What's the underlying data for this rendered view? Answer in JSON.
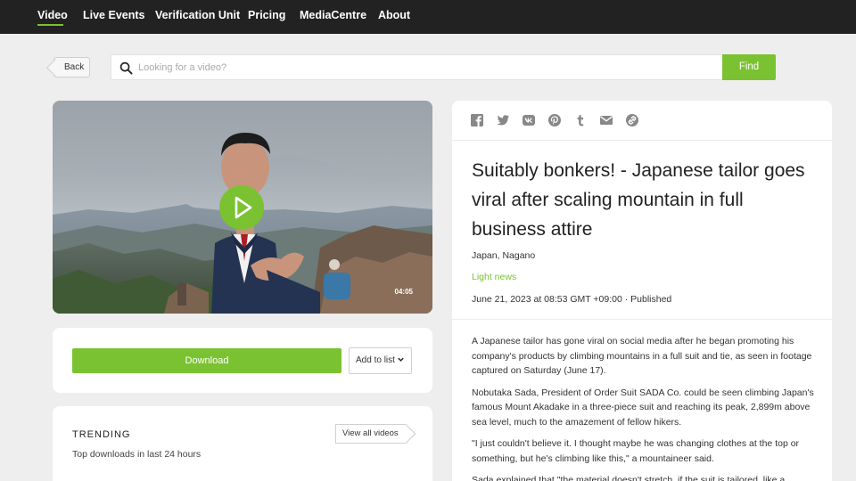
{
  "nav": {
    "items": [
      "Video",
      "Live Events",
      "Verification Unit",
      "Pricing",
      "MediaCentre",
      "About"
    ],
    "active": "Video"
  },
  "search": {
    "back_label": "Back",
    "placeholder": "Looking for a video?",
    "value": "",
    "find_label": "Find"
  },
  "video": {
    "duration": "04:05"
  },
  "actions": {
    "download_label": "Download",
    "add_to_list_label": "Add to list"
  },
  "trending": {
    "title": "TRENDING",
    "subtitle": "Top downloads in last 24 hours",
    "view_all_label": "View all videos"
  },
  "share": {
    "icons": [
      "facebook-icon",
      "twitter-icon",
      "vk-icon",
      "pinterest-icon",
      "tumblr-icon",
      "email-icon",
      "link-icon"
    ]
  },
  "article": {
    "headline": "Suitably bonkers! - Japanese tailor goes viral after scaling mountain in full business attire",
    "location": "Japan, Nagano",
    "category": "Light news",
    "published": "June 21, 2023 at 08:53 GMT +09:00 · Published",
    "paragraphs": [
      "A Japanese tailor has gone viral on social media after he began promoting his company's products by climbing mountains in a full suit and tie, as seen in footage captured on Saturday (June 17).",
      "Nobutaka Sada, President of Order Suit SADA Co. could be seen climbing Japan's famous Mount Akadake in a three-piece suit and reaching its peak, 2,899m above sea level, much to the amazement of fellow hikers.",
      "\"I just couldn't believe it. I thought maybe he was changing clothes at the top or something, but he's climbing like this,\" a mountaineer said.",
      "Sada explained that \"the material doesn't stretch, if the suit is tailored, like a"
    ]
  },
  "colors": {
    "accent": "#7ac231",
    "nav_bg": "#222222",
    "page_bg": "#eeeeee"
  }
}
